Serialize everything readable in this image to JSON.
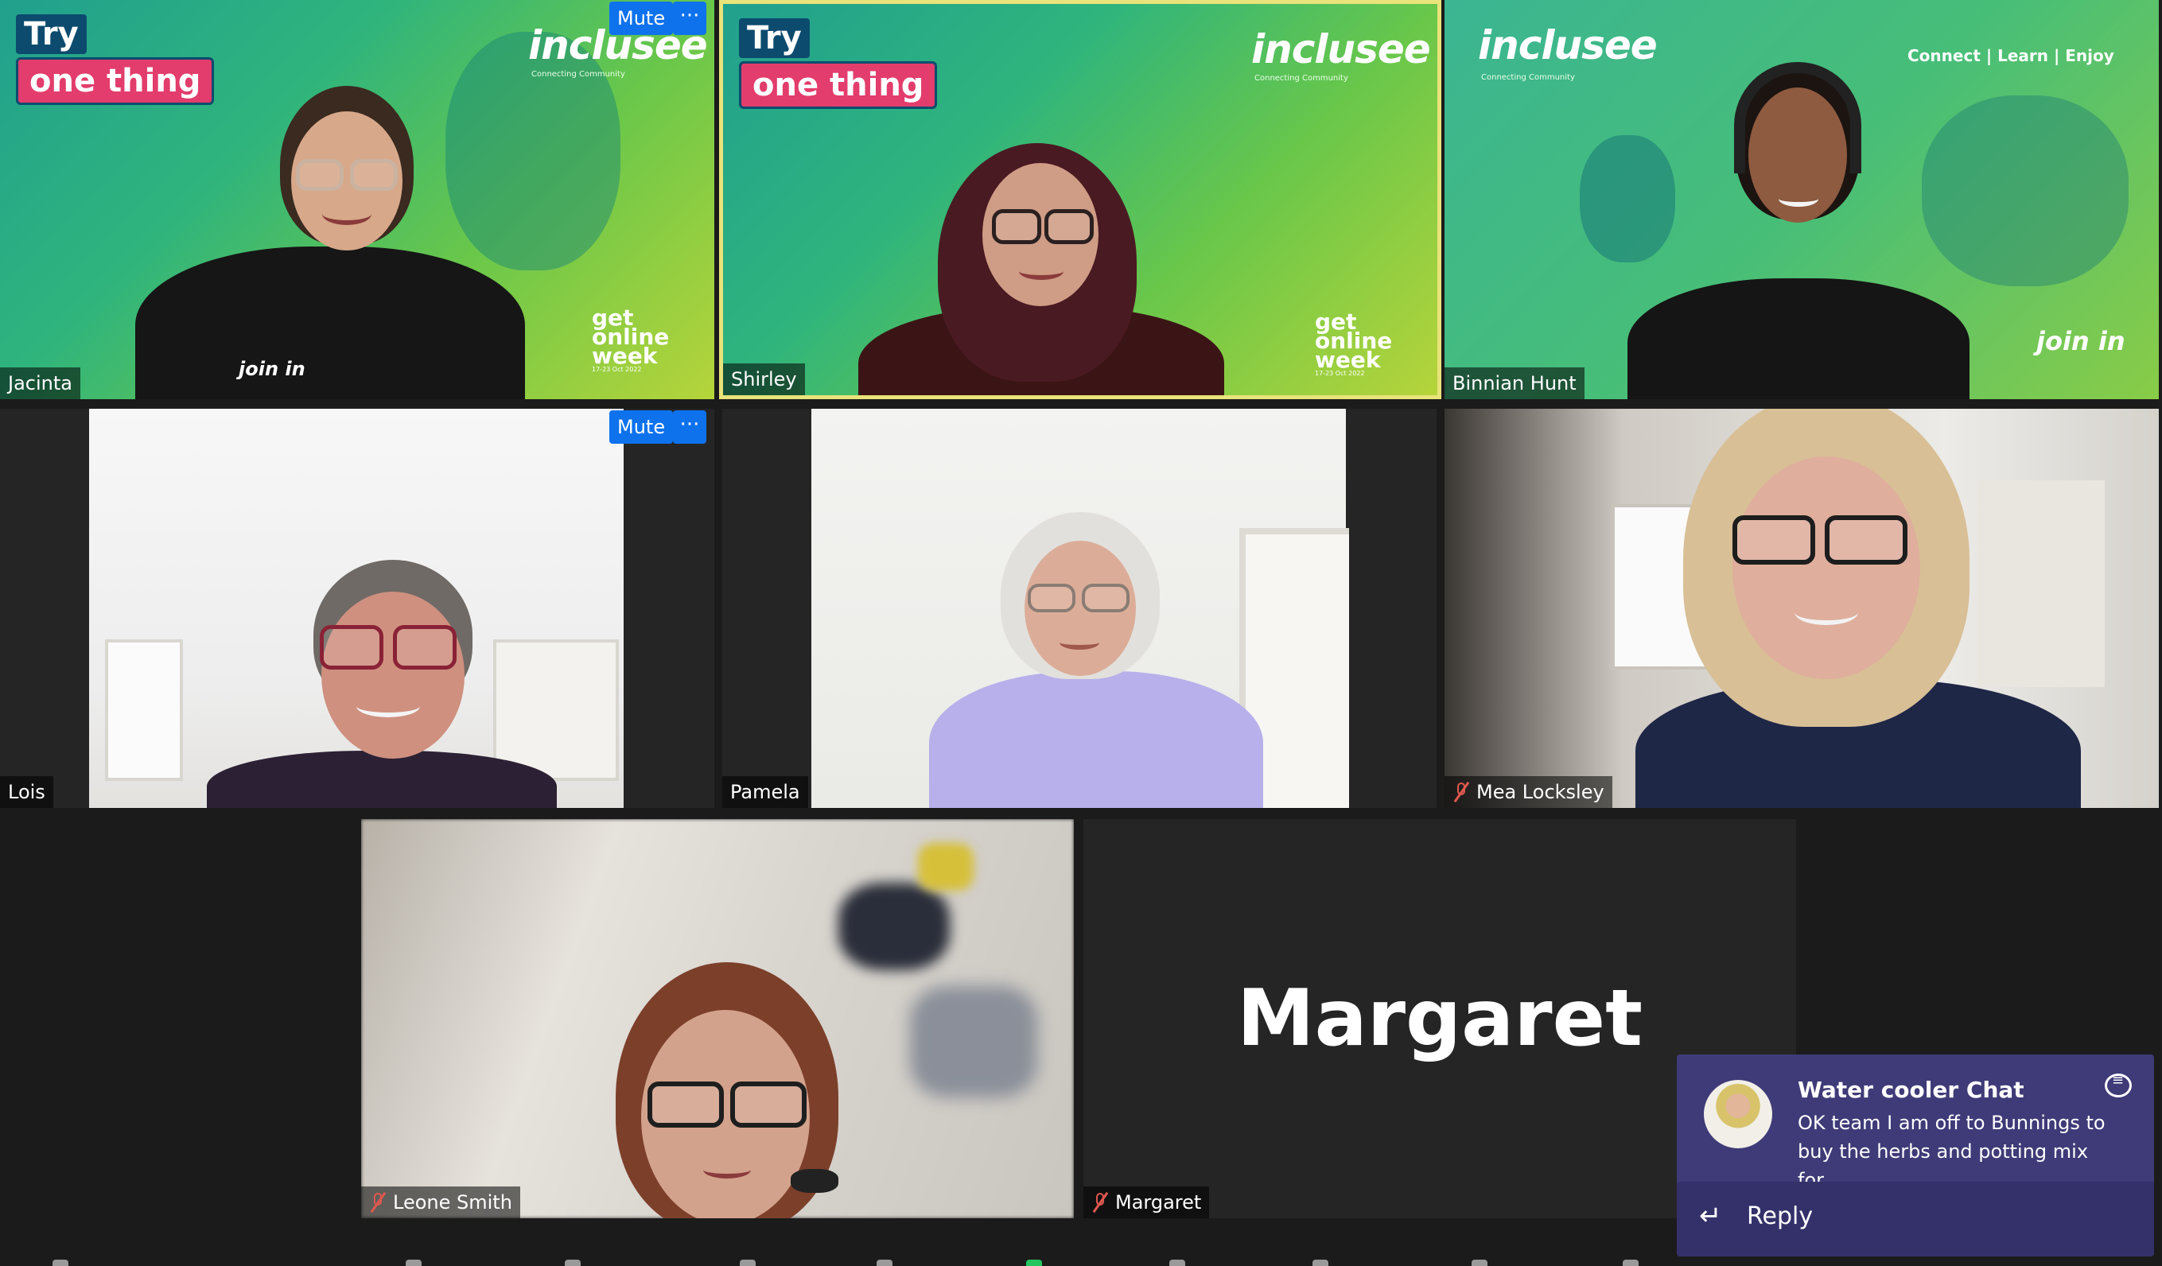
{
  "participants": [
    {
      "name": "Jacinta",
      "muted": false
    },
    {
      "name": "Shirley",
      "muted": false,
      "active_speaker": true
    },
    {
      "name": "Binnian Hunt",
      "muted": false
    },
    {
      "name": "Lois",
      "muted": false
    },
    {
      "name": "Pamela",
      "muted": false
    },
    {
      "name": "Mea Locksley",
      "muted": true
    },
    {
      "name": "Leone Smith",
      "muted": true
    },
    {
      "name": "Margaret",
      "muted": true,
      "video_off": true
    }
  ],
  "controls": {
    "mute_label": "Mute",
    "more_label": "···"
  },
  "branding": {
    "try_label": "Try",
    "one_thing_label": "one thing",
    "logo": "inclusee",
    "logo_tagline": "Connecting Community",
    "tagline": "Connect | Learn | Enjoy",
    "get_online_week": "get online week",
    "get_online_dates": "17-23 Oct 2022",
    "shirt_text": "join in"
  },
  "video_off_name": "Margaret",
  "chat_notification": {
    "title": "Water cooler Chat",
    "message": "OK team I am off to Bunnings to buy the herbs and potting mix for...",
    "reply_label": "Reply"
  },
  "colors": {
    "active_speaker_border": "#e8e37a",
    "control_blue": "#0e72ed",
    "muted_red": "#e0584f",
    "toast_bg": "#3f3b78"
  }
}
